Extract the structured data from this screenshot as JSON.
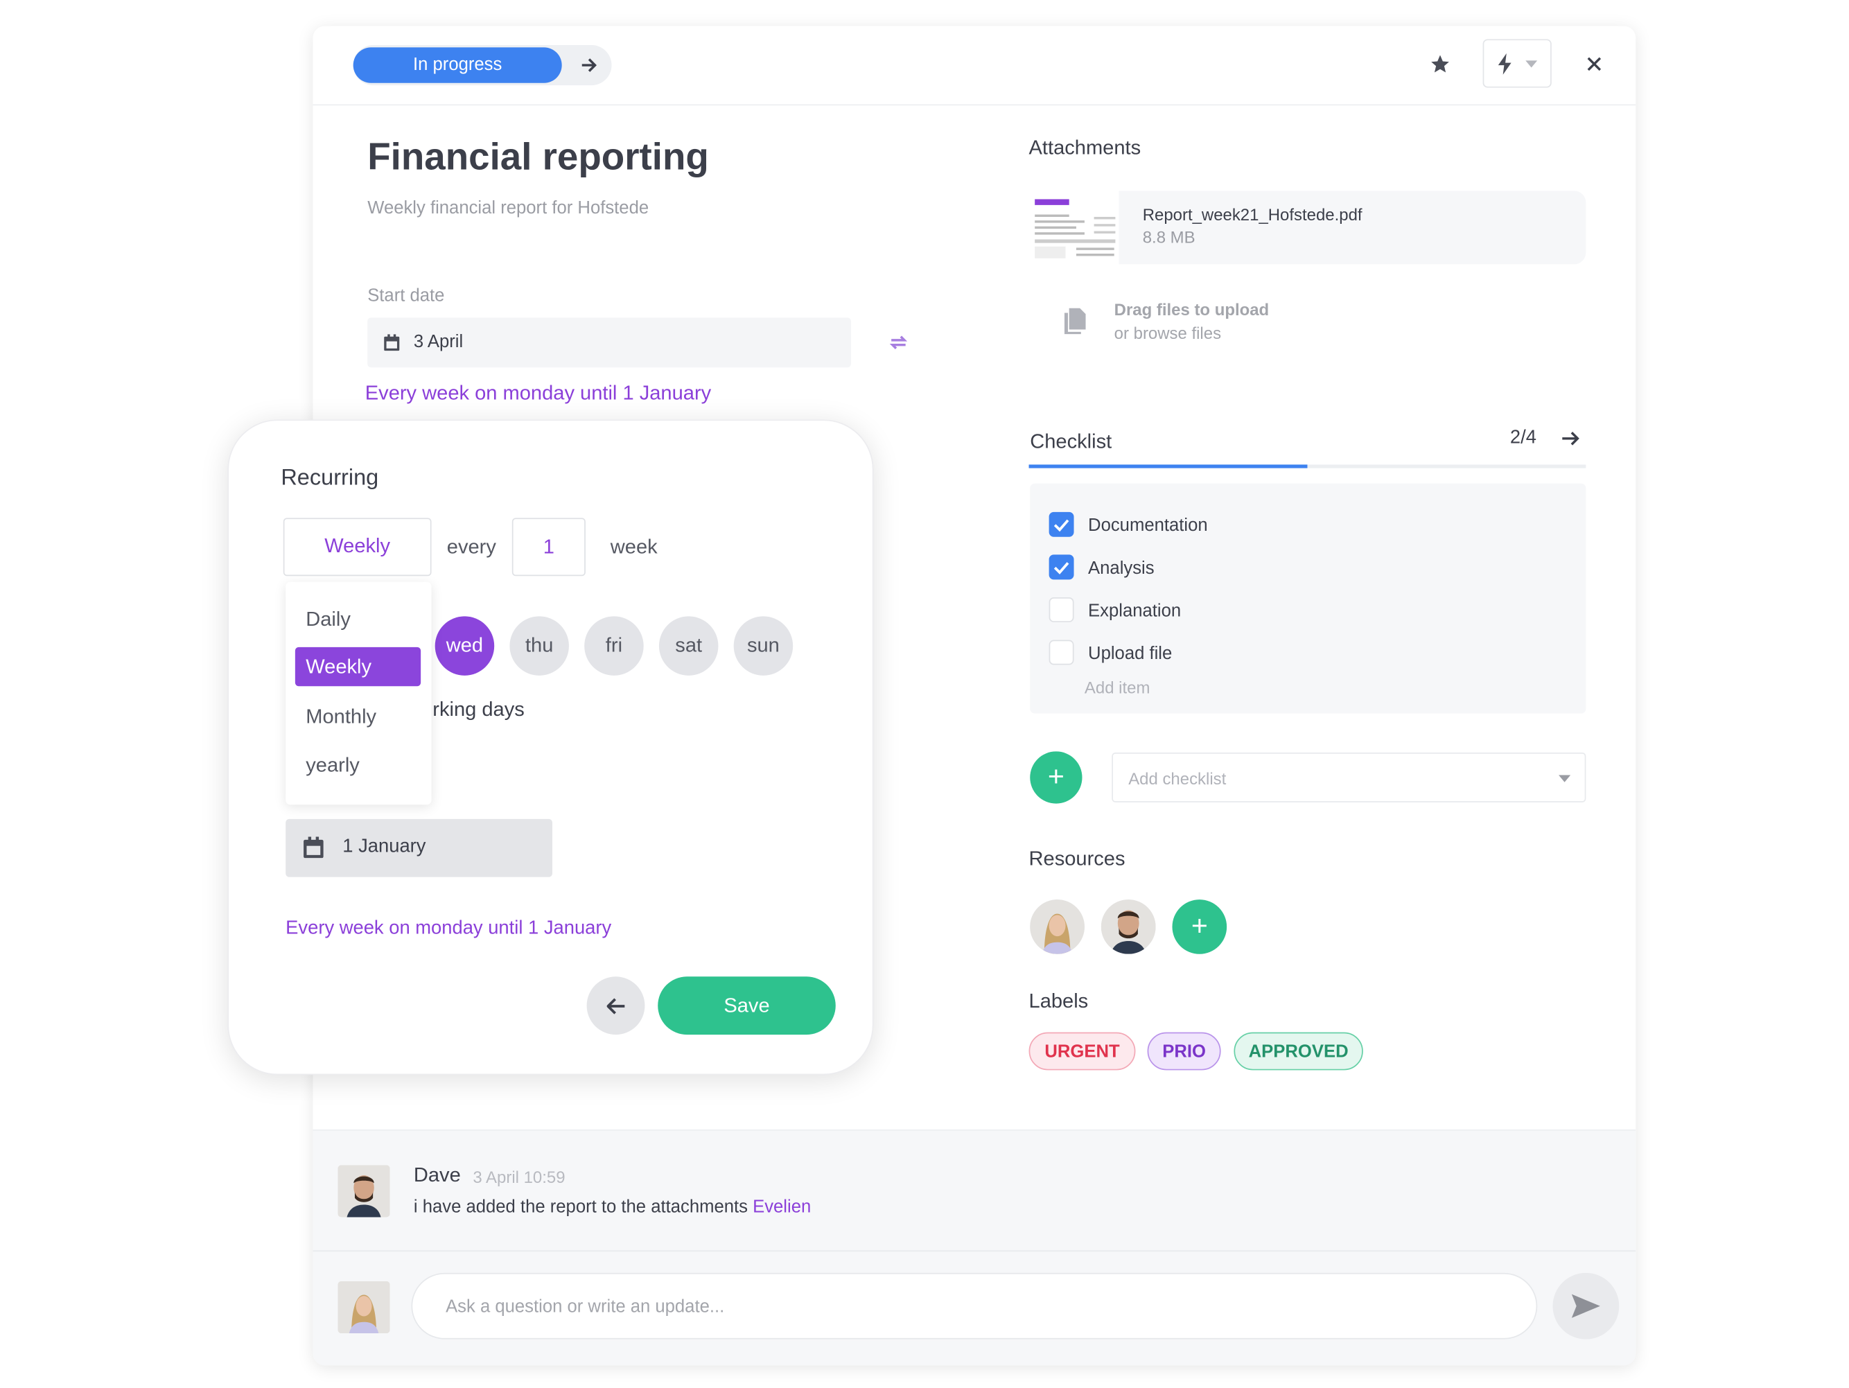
{
  "header": {
    "status": "In progress",
    "icons": [
      "arrow-right-icon",
      "star-icon",
      "lightning-icon",
      "chevron-down-icon",
      "close-icon"
    ]
  },
  "task": {
    "title": "Financial reporting",
    "subtitle": "Weekly financial report for Hofstede",
    "start_date_label": "Start date",
    "start_date": "3 April",
    "recurrence_summary": "Every week on monday until 1 January"
  },
  "recurring": {
    "title": "Recurring",
    "frequency": "Weekly",
    "every_label": "every",
    "interval": "1",
    "unit": "week",
    "options": [
      "Daily",
      "Weekly",
      "Monthly",
      "yearly"
    ],
    "selected_option": "Weekly",
    "days": [
      {
        "label": "wed",
        "selected": true
      },
      {
        "label": "thu",
        "selected": false
      },
      {
        "label": "fri",
        "selected": false
      },
      {
        "label": "sat",
        "selected": false
      },
      {
        "label": "sun",
        "selected": false
      }
    ],
    "working_days_label": "rking days",
    "end_date": "1 January",
    "summary": "Every week on monday until 1 January",
    "save_label": "Save"
  },
  "attachments": {
    "title": "Attachments",
    "file_name": "Report_week21_Hofstede.pdf",
    "file_size": "8.8 MB",
    "upload_line1": "Drag files to upload",
    "upload_line2": "or browse files"
  },
  "checklist": {
    "title": "Checklist",
    "count": "2/4",
    "progress": 0.5,
    "items": [
      {
        "label": "Documentation",
        "checked": true
      },
      {
        "label": "Analysis",
        "checked": true
      },
      {
        "label": "Explanation",
        "checked": false
      },
      {
        "label": "Upload file",
        "checked": false
      }
    ],
    "add_item": "Add item",
    "add_checklist_placeholder": "Add checklist"
  },
  "resources": {
    "title": "Resources"
  },
  "labels": {
    "title": "Labels",
    "items": [
      {
        "text": "URGENT",
        "color": "#e0334d"
      },
      {
        "text": "PRIO",
        "color": "#7b35c9"
      },
      {
        "text": "APPROVED",
        "color": "#23926a"
      }
    ]
  },
  "comments": [
    {
      "author": "Dave",
      "time": "3 April 10:59",
      "text": "i have added the report to the attachments",
      "mention": "Evelien"
    }
  ],
  "composer": {
    "placeholder": "Ask a question or write an update..."
  },
  "colors": {
    "accent_blue": "#3d82f0",
    "accent_purple": "#8b3fd9",
    "accent_green": "#2ec28e"
  }
}
